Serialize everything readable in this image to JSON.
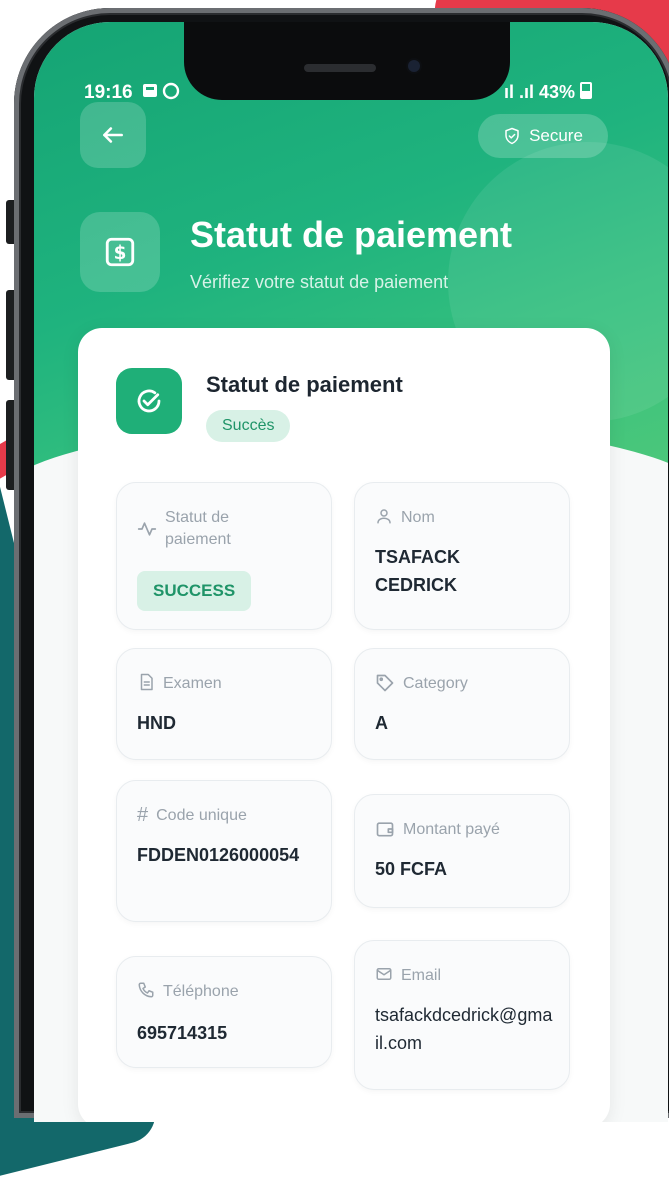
{
  "status_bar": {
    "time": "19:16",
    "battery": "43%"
  },
  "header": {
    "secure_label": "Secure",
    "title": "Statut de paiement",
    "subtitle": "Vérifiez votre statut de paiement"
  },
  "card": {
    "title": "Statut de paiement",
    "badge": "Succès"
  },
  "fields": {
    "statut": {
      "label": "Statut de paiement",
      "value": "SUCCESS"
    },
    "nom": {
      "label": "Nom",
      "value": "TSAFACK CEDRICK"
    },
    "examen": {
      "label": "Examen",
      "value": "HND"
    },
    "category": {
      "label": "Category",
      "value": "A"
    },
    "code": {
      "label": "Code unique",
      "value": "FDDEN0126000054"
    },
    "montant": {
      "label": "Montant payé",
      "value": "50 FCFA"
    },
    "telephone": {
      "label": "Téléphone",
      "value": "695714315"
    },
    "email": {
      "label": "Email",
      "value": "tsafackdcedrick@gmail.com"
    }
  },
  "colors": {
    "primary": "#1faf78",
    "badge_bg": "#d8f1e6",
    "badge_text": "#1f9468"
  },
  "icons": [
    "arrow-left-icon",
    "shield-icon",
    "receipt-icon",
    "check-circle-icon",
    "activity-icon",
    "user-icon",
    "document-icon",
    "tag-icon",
    "hash-icon",
    "wallet-icon",
    "phone-icon",
    "mail-icon"
  ]
}
